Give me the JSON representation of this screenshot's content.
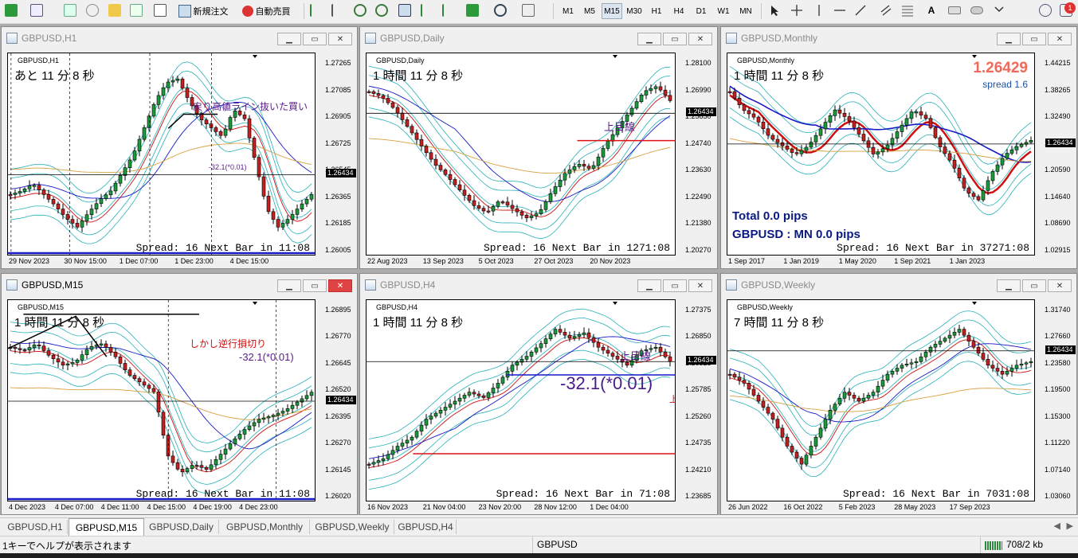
{
  "toolbar": {
    "new_order_label": "新規注文",
    "auto_trade_label": "自動売買",
    "timeframes": [
      "M1",
      "M5",
      "M15",
      "M30",
      "H1",
      "H4",
      "D1",
      "W1",
      "MN"
    ],
    "active_timeframe": "M15",
    "notification_badge": "1"
  },
  "colors": {
    "bull": "#1a9a3a",
    "bear": "#c42020",
    "band": "#26b0b8",
    "ma_red": "#d01010",
    "ma_blue": "#1818c8",
    "ma_orange": "#d8a040",
    "hline_blue": "#1818c8",
    "hline_red": "#e01010"
  },
  "windows": [
    {
      "title": "GBPUSD,H1",
      "symbol": "GBPUSD,H1",
      "countdown": "あと 11 分 8 秒",
      "price_labels": [
        "1.27265",
        "1.27085",
        "1.26905",
        "1.26725",
        "1.26545",
        "1.26365",
        "1.26185",
        "1.26005"
      ],
      "current_price": "1.26434",
      "time_labels": [
        "29 Nov 2023",
        "30 Nov 15:00",
        "1 Dec 07:00",
        "1 Dec 23:00",
        "4 Dec 15:00"
      ],
      "spread_text": "Spread: 16  Next Bar in 11:08",
      "annotations": [
        "戻り高値ライン抜いた買い",
        "-32.1(*0.01)"
      ]
    },
    {
      "title": "GBPUSD,Daily",
      "symbol": "GBPUSD,Daily",
      "countdown": "1 時間 11 分 8 秒",
      "price_labels": [
        "1.28100",
        "1.26990",
        "1.25850",
        "1.24740",
        "1.23630",
        "1.22490",
        "1.21380",
        "1.20270"
      ],
      "current_price": "1.26434",
      "time_labels": [
        "22 Aug 2023",
        "13 Sep 2023",
        "5 Oct 2023",
        "27 Oct 2023",
        "20 Nov 2023"
      ],
      "spread_text": "Spread: 16  Next Bar in 1271:08",
      "annotations": [
        "上目線"
      ]
    },
    {
      "title": "GBPUSD,Monthly",
      "symbol": "GBPUSD,Monthly",
      "countdown": "1 時間 11 分 8 秒",
      "price_labels": [
        "1.44215",
        "1.38265",
        "1.32490",
        "1.26434",
        "1.20590",
        "1.14640",
        "1.08690",
        "1.02915"
      ],
      "current_price": "1.26434",
      "time_labels": [
        "1 Sep 2017",
        "1 Jan 2019",
        "1 May 2020",
        "1 Sep 2021",
        "1 Jan 2023"
      ],
      "spread_text": "Spread: 16  Next Bar in 37271:08",
      "big_price": "1.26429",
      "spread_small": "spread 1.6",
      "total_pips": "Total 0.0 pips",
      "pair_pips": "GBPUSD : MN 0.0 pips"
    },
    {
      "title": "GBPUSD,M15",
      "symbol": "GBPUSD,M15",
      "countdown": "1 時間 11 分 8 秒",
      "price_labels": [
        "1.26895",
        "1.26770",
        "1.26645",
        "1.26520",
        "1.26395",
        "1.26270",
        "1.26145",
        "1.26020"
      ],
      "current_price": "1.26434",
      "time_labels": [
        "4 Dec 2023",
        "4 Dec 07:00",
        "4 Dec 11:00",
        "4 Dec 15:00",
        "4 Dec 19:00",
        "4 Dec 23:00"
      ],
      "spread_text": "Spread: 16  Next Bar in 11:08",
      "annotations": [
        "しかし逆行損切り",
        "-32.1(*0.01)"
      ]
    },
    {
      "title": "GBPUSD,H4",
      "symbol": "GBPUSD,H4",
      "countdown": "1 時間 11 分 8 秒",
      "price_labels": [
        "1.27375",
        "1.26850",
        "1.26325",
        "1.25785",
        "1.25260",
        "1.24735",
        "1.24210",
        "1.23685"
      ],
      "current_price": "1.26434",
      "time_labels": [
        "16 Nov 2023",
        "21 Nov 04:00",
        "23 Nov 20:00",
        "28 Nov 12:00",
        "1 Dec 04:00"
      ],
      "spread_text": "Spread: 16  Next Bar in 71:08",
      "annotations": [
        "上目線",
        "-32.1(*0.01)",
        "上"
      ]
    },
    {
      "title": "GBPUSD,Weekly",
      "symbol": "GBPUSD,Weekly",
      "countdown": "7 時間 11 分 8 秒",
      "price_labels": [
        "1.31740",
        "1.27660",
        "1.23580",
        "1.19500",
        "1.15300",
        "1.11220",
        "1.07140",
        "1.03060"
      ],
      "current_price": "1.26434",
      "time_labels": [
        "26 Jun 2022",
        "16 Oct 2022",
        "5 Feb 2023",
        "28 May 2023",
        "17 Sep 2023"
      ],
      "spread_text": "Spread: 16  Next Bar in 7031:08"
    }
  ],
  "tabs": [
    "GBPUSD,H1",
    "GBPUSD,M15",
    "GBPUSD,Daily",
    "GBPUSD,Monthly",
    "GBPUSD,Weekly",
    "GBPUSD,H4"
  ],
  "active_tab": "GBPUSD,M15",
  "status": {
    "help_text": "1キーでヘルプが表示されます",
    "symbol": "GBPUSD",
    "traffic": "708/2 kb"
  }
}
